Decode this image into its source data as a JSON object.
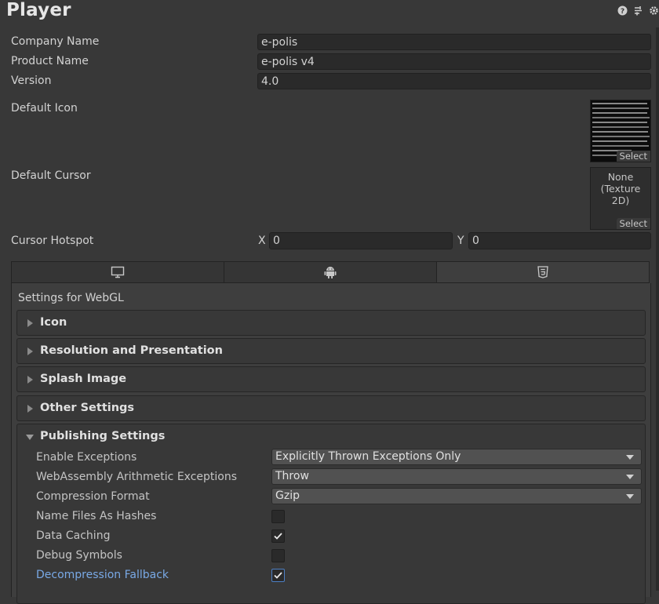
{
  "header": {
    "title": "Player",
    "icons": [
      "help-icon",
      "preset-icon",
      "settings-icon"
    ]
  },
  "fields": {
    "company_name": {
      "label": "Company Name",
      "value": "e-polis"
    },
    "product_name": {
      "label": "Product Name",
      "value": "e-polis v4"
    },
    "version": {
      "label": "Version",
      "value": "4.0"
    },
    "default_icon": {
      "label": "Default Icon",
      "select": "Select"
    },
    "default_cursor": {
      "label": "Default Cursor",
      "value_line1": "None",
      "value_line2": "(Texture 2D)",
      "select": "Select"
    },
    "cursor_hotspot": {
      "label": "Cursor Hotspot",
      "x_label": "X",
      "x_value": "0",
      "y_label": "Y",
      "y_value": "0"
    }
  },
  "platform_tabs": [
    {
      "icon": "monitor-icon",
      "selected": false
    },
    {
      "icon": "android-icon",
      "selected": false
    },
    {
      "icon": "html5-icon",
      "selected": true
    }
  ],
  "settings_for": "Settings for WebGL",
  "sections": {
    "icon": "Icon",
    "resolution": "Resolution and Presentation",
    "splash": "Splash Image",
    "other": "Other Settings",
    "publishing": "Publishing Settings"
  },
  "publishing": {
    "enable_exceptions": {
      "label": "Enable Exceptions",
      "value": "Explicitly Thrown Exceptions Only"
    },
    "wasm_arith": {
      "label": "WebAssembly Arithmetic Exceptions",
      "value": "Throw"
    },
    "compression": {
      "label": "Compression Format",
      "value": "Gzip"
    },
    "name_hashes": {
      "label": "Name Files As Hashes",
      "checked": false
    },
    "data_caching": {
      "label": "Data Caching",
      "checked": true
    },
    "debug_symbols": {
      "label": "Debug Symbols",
      "checked": false
    },
    "decompression_fallback": {
      "label": "Decompression Fallback",
      "checked": true
    }
  },
  "colors": {
    "background": "#383838",
    "field": "#2a2a2a",
    "highlight_label": "#79a9e6"
  }
}
